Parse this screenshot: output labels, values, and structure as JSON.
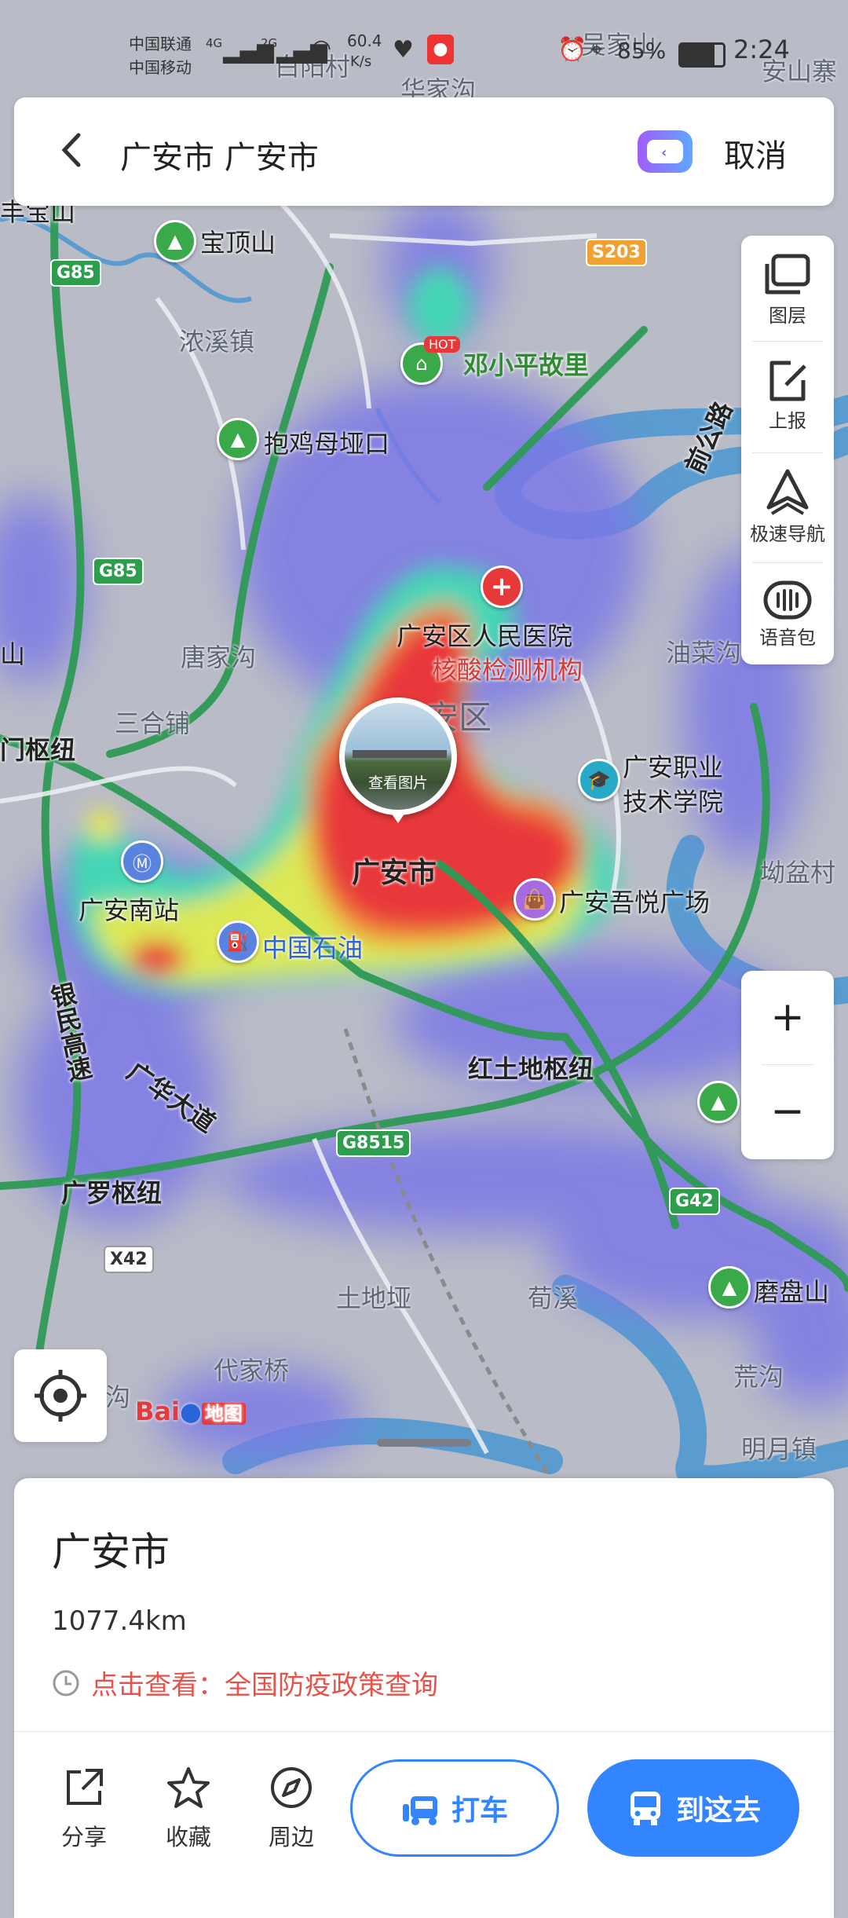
{
  "status": {
    "carrier1": "中国联通",
    "carrier2": "中国移动",
    "net1": "4G",
    "net2": "2G",
    "speed_value": "60.4",
    "speed_unit": "K/s",
    "battery": "85%",
    "time": "2:24"
  },
  "search": {
    "back_icon": "back-arrow-icon",
    "query": "广安市 广安市",
    "cancel": "取消"
  },
  "right_panel": {
    "layers": "图层",
    "report": "上报",
    "fast_nav": "极速导航",
    "voice": "语音包"
  },
  "zoom": {
    "in": "+",
    "out": "−"
  },
  "map_labels": {
    "baidingshan": "宝顶山",
    "nongxi": "浓溪镇",
    "baojimu": "抱鸡母垭口",
    "deng": "邓小平故里",
    "hot": "HOT",
    "hospital": "广安区人民医院",
    "testing": "核酸检测机构",
    "district": "广安区",
    "tangjiagou": "唐家沟",
    "sanhepu": "三合铺",
    "shunzhu": "门枢纽",
    "shan_left": "山",
    "youcai": "油菜沟",
    "vocational1": "广安职业",
    "vocational2": "技术学院",
    "aopen": "坳盆村",
    "city": "广安市",
    "photo_caption": "查看图片",
    "wuyue": "广安吾悦广场",
    "nanzhan": "广安南站",
    "petro": "中国石油",
    "yinmin": "银民高速",
    "guanghua": "广华大道",
    "hongtudi": "红土地枢纽",
    "guangluo": "广罗枢纽",
    "tudiya": "土地垭",
    "xunxi": "荀溪",
    "modeshan": "磨盘山",
    "huanggou": "荒沟",
    "daijiaqiao": "代家桥",
    "mingyue": "明月镇",
    "gou": "沟",
    "baijiagou": "华家沟",
    "baiyang": "白阳村",
    "anshan": "安山寨",
    "wujiashan": "吴家山",
    "fengbao": "丰宝山",
    "zhouqian": "前公路",
    "baidu1": "Bai",
    "baidu2": "地图"
  },
  "shields": {
    "g85a": "G85",
    "g85b": "G85",
    "s203": "S203",
    "g8515": "G8515",
    "g42": "G42",
    "g42b": "G42",
    "x42": "X42"
  },
  "bottom_card": {
    "title": "广安市",
    "distance": "1077.4km",
    "notice_prefix": "点击查看：",
    "notice_text": "全国防疫政策查询",
    "share": "分享",
    "favorite": "收藏",
    "nearby": "周边",
    "taxi": "打车",
    "go_there": "到这去"
  },
  "colors": {
    "accent": "#3385ff",
    "heat_red": "#e8393a",
    "notice_red": "#e5534b",
    "map_bg": "#b9bcc6"
  }
}
